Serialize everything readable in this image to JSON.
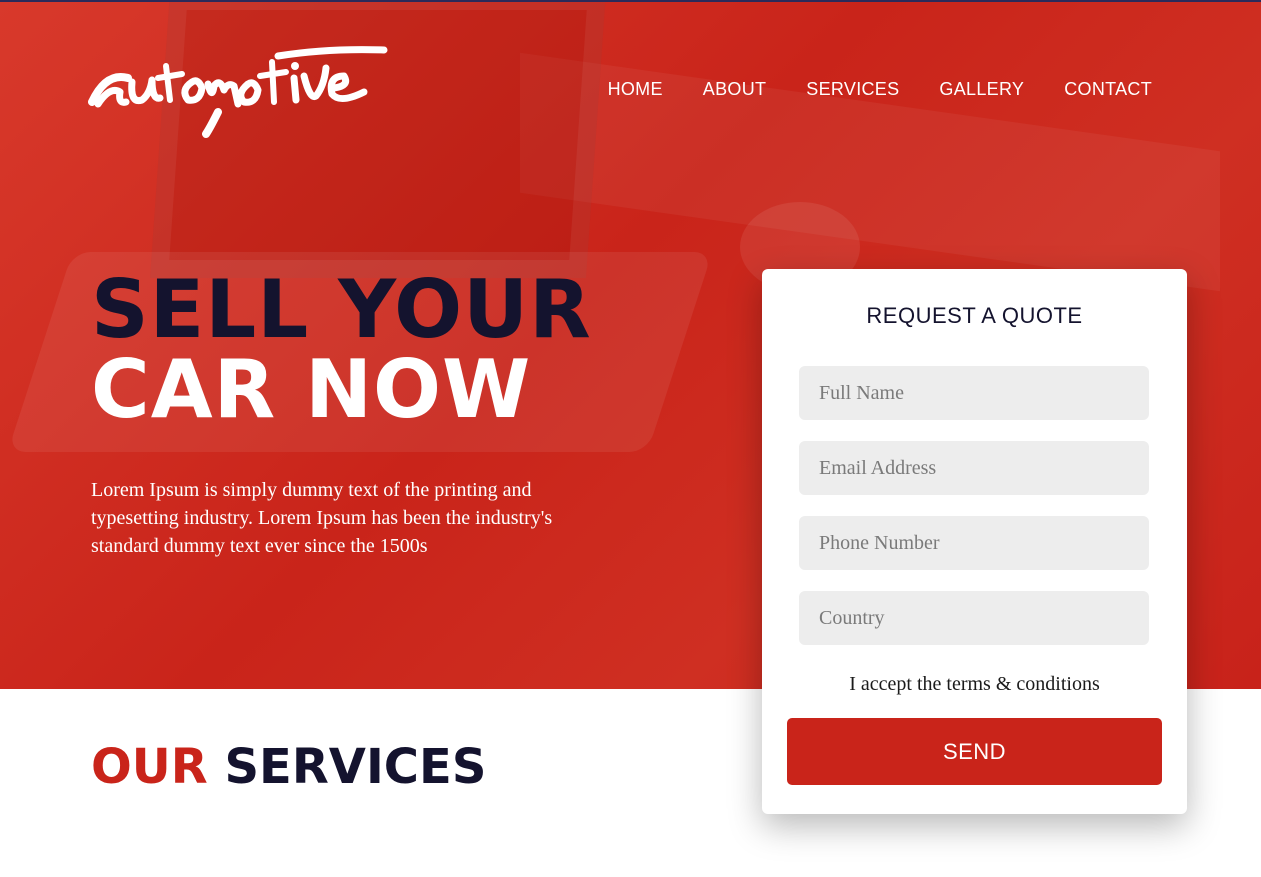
{
  "brand": {
    "logo_text": "automotive",
    "colors": {
      "primary": "#c9241a",
      "dark": "#14132e",
      "field": "#ededed"
    }
  },
  "nav": {
    "items": [
      "HOME",
      "ABOUT",
      "SERVICES",
      "GALLERY",
      "CONTACT"
    ]
  },
  "hero": {
    "headline_line1": "SELL YOUR",
    "headline_line2": "CAR NOW",
    "intro": "Lorem Ipsum is simply dummy text of the printing and typesetting industry. Lorem Ipsum has been the industry's standard dummy text ever since the 1500s"
  },
  "quote_form": {
    "title": "REQUEST A QUOTE",
    "fields": {
      "full_name": {
        "placeholder": "Full Name",
        "value": ""
      },
      "email": {
        "placeholder": "Email Address",
        "value": ""
      },
      "phone": {
        "placeholder": "Phone Number",
        "value": ""
      },
      "country": {
        "placeholder": "Country",
        "value": ""
      }
    },
    "terms_label": "I accept the terms & conditions",
    "send_label": "SEND"
  },
  "services": {
    "title_part1": "OUR",
    "title_part2": "SERVICES"
  }
}
